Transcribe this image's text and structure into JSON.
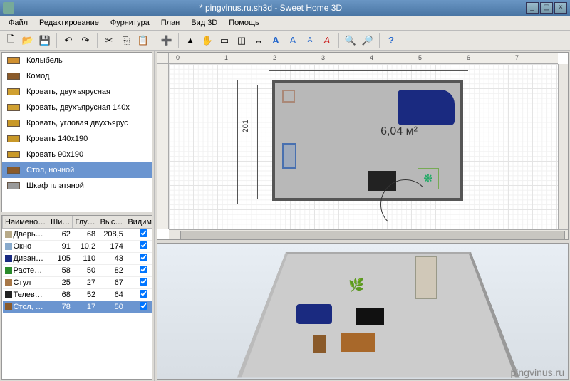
{
  "window": {
    "title": "* pingvinus.ru.sh3d - Sweet Home 3D"
  },
  "menu": [
    "Файл",
    "Редактирование",
    "Фурнитура",
    "План",
    "Вид 3D",
    "Помощь"
  ],
  "catalog": {
    "items": [
      {
        "label": "Колыбель",
        "color": "#d09030"
      },
      {
        "label": "Комод",
        "color": "#8a5a2a"
      },
      {
        "label": "Кровать, двухъярусная",
        "color": "#d0a030"
      },
      {
        "label": "Кровать, двухъярусная 140x",
        "color": "#d0a030"
      },
      {
        "label": "Кровать, угловая двухъярус",
        "color": "#c89828"
      },
      {
        "label": "Кровать 140x190",
        "color": "#c89828"
      },
      {
        "label": "Кровать 90x190",
        "color": "#c89828"
      },
      {
        "label": "Стол, ночной",
        "color": "#8a5a2a",
        "selected": true
      },
      {
        "label": "Шкаф платяной",
        "color": "#999"
      }
    ]
  },
  "plan": {
    "ruler_marks": [
      "0",
      "1",
      "2",
      "3",
      "4",
      "5",
      "6",
      "7"
    ],
    "room_area": "6,04 м²",
    "dimension_label": "201"
  },
  "furniture_table": {
    "headers": [
      "Наимено…",
      "Ши…",
      "Глу…",
      "Выс…",
      "Видим…"
    ],
    "rows": [
      {
        "name": "Дверь…",
        "w": "62",
        "d": "68",
        "h": "208,5",
        "vis": true,
        "ico": "#b8aa88"
      },
      {
        "name": "Окно",
        "w": "91",
        "d": "10,2",
        "h": "174",
        "vis": true,
        "ico": "#88aacc"
      },
      {
        "name": "Диван…",
        "w": "105",
        "d": "110",
        "h": "43",
        "vis": true,
        "ico": "#1a2a80"
      },
      {
        "name": "Расте…",
        "w": "58",
        "d": "50",
        "h": "82",
        "vis": true,
        "ico": "#2a8a2a"
      },
      {
        "name": "Стул",
        "w": "25",
        "d": "27",
        "h": "67",
        "vis": true,
        "ico": "#a87848"
      },
      {
        "name": "Телев…",
        "w": "68",
        "d": "52",
        "h": "64",
        "vis": true,
        "ico": "#222"
      },
      {
        "name": "Стол, …",
        "w": "78",
        "d": "17",
        "h": "50",
        "vis": true,
        "ico": "#8a5a2a",
        "selected": true
      }
    ]
  },
  "watermark": "pingvinus.ru"
}
